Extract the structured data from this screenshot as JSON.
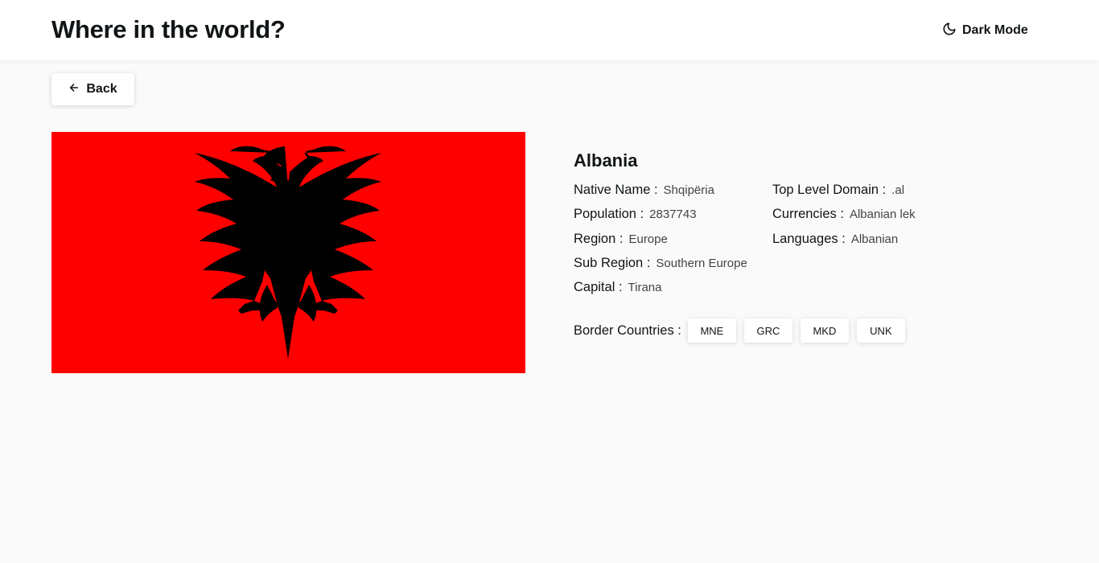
{
  "header": {
    "title": "Where in the world?",
    "dark_mode_label": "Dark Mode",
    "dark_mode_icon": "moon-icon"
  },
  "back_button": {
    "label": "Back",
    "icon": "arrow-left-icon"
  },
  "country": {
    "name": "Albania",
    "flag_colors": {
      "field": "#ff0000",
      "eagle": "#000000"
    },
    "left_fields": [
      {
        "label": "Native Name :",
        "value": "Shqipëria"
      },
      {
        "label": "Population :",
        "value": "2837743"
      },
      {
        "label": "Region :",
        "value": "Europe"
      },
      {
        "label": "Sub Region :",
        "value": "Southern Europe"
      },
      {
        "label": "Capital :",
        "value": "Tirana"
      }
    ],
    "right_fields": [
      {
        "label": "Top Level Domain :",
        "value": ".al"
      },
      {
        "label": "Currencies :",
        "value": "Albanian lek"
      },
      {
        "label": "Languages :",
        "value": "Albanian"
      }
    ],
    "border_label": "Border Countries :",
    "borders": [
      "MNE",
      "GRC",
      "MKD",
      "UNK"
    ]
  }
}
